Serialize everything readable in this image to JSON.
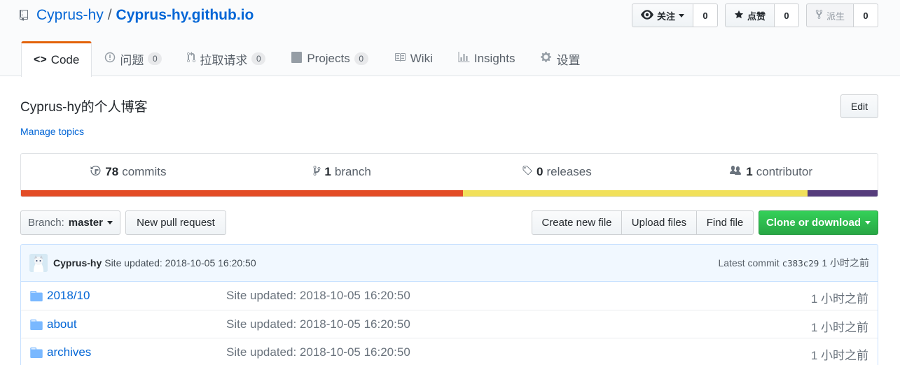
{
  "repo": {
    "owner": "Cyprus-hy",
    "separator": "/",
    "name": "Cyprus-hy.github.io"
  },
  "actions": {
    "watch": {
      "label": "关注",
      "count": "0",
      "icon": "eye-icon"
    },
    "star": {
      "label": "点赞",
      "count": "0",
      "icon": "star-icon"
    },
    "fork": {
      "label": "派生",
      "count": "0",
      "icon": "fork-icon"
    }
  },
  "tabs": [
    {
      "label": "Code",
      "icon": "code-icon",
      "selected": true
    },
    {
      "label": "问题",
      "icon": "issue-icon",
      "counter": "0"
    },
    {
      "label": "拉取请求",
      "icon": "pull-request-icon",
      "counter": "0"
    },
    {
      "label": "Projects",
      "icon": "project-icon",
      "counter": "0"
    },
    {
      "label": "Wiki",
      "icon": "book-icon"
    },
    {
      "label": "Insights",
      "icon": "graph-icon"
    },
    {
      "label": "设置",
      "icon": "gear-icon"
    }
  ],
  "description": "Cyprus-hy的个人博客",
  "manage_topics": "Manage topics",
  "edit_label": "Edit",
  "summary": {
    "commits": {
      "num": "78",
      "label": "commits"
    },
    "branches": {
      "num": "1",
      "label": "branch"
    },
    "releases": {
      "num": "0",
      "label": "releases"
    },
    "contributors": {
      "num": "1",
      "label": "contributor"
    }
  },
  "languages": [
    {
      "color": "#e34c26",
      "fraction": 0.516
    },
    {
      "color": "#f1e05a",
      "fraction": 0.402
    },
    {
      "color": "#563d7c",
      "fraction": 0.082
    }
  ],
  "file_nav": {
    "branch_prefix": "Branch:",
    "branch_name": "master",
    "new_pr": "New pull request",
    "create_file": "Create new file",
    "upload_files": "Upload files",
    "find_file": "Find file",
    "clone": "Clone or download"
  },
  "latest_commit": {
    "author": "Cyprus-hy",
    "message": "Site updated: 2018-10-05 16:20:50",
    "label": "Latest commit",
    "sha": "c383c29",
    "age": "1 小时之前"
  },
  "files": [
    {
      "name": "2018/10",
      "message": "Site updated: 2018-10-05 16:20:50",
      "age": "1 小时之前"
    },
    {
      "name": "about",
      "message": "Site updated: 2018-10-05 16:20:50",
      "age": "1 小时之前"
    },
    {
      "name": "archives",
      "message": "Site updated: 2018-10-05 16:20:50",
      "age": "1 小时之前"
    }
  ]
}
